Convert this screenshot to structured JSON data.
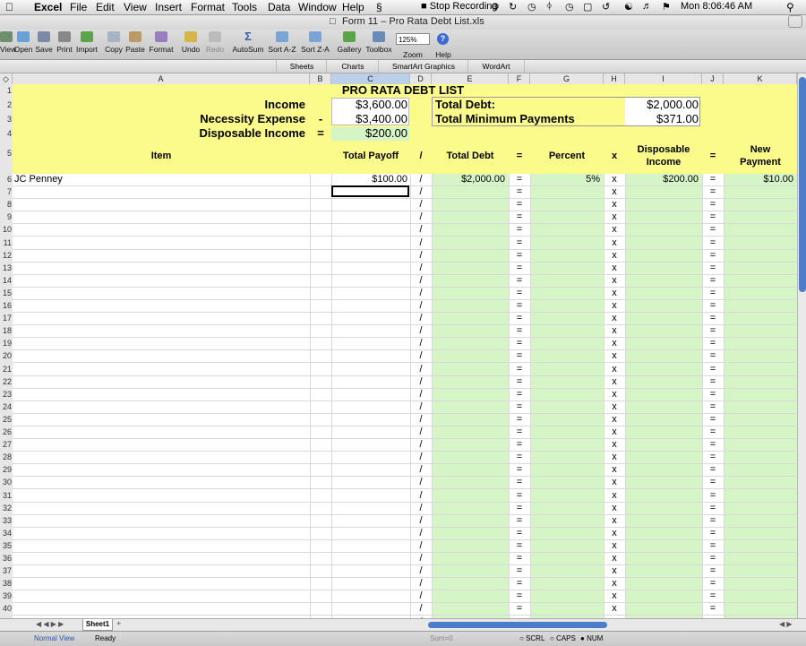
{
  "menubar": {
    "app": "Excel",
    "items": [
      "File",
      "Edit",
      "View",
      "Insert",
      "Format",
      "Tools",
      "Data",
      "Window",
      "Help"
    ],
    "stop_recording": "Stop Recording",
    "clock": "Mon 8:06:46 AM"
  },
  "window": {
    "title": "Form 11 – Pro Rata Debt List.xls"
  },
  "toolbar": {
    "buttons": [
      "View",
      "Open",
      "Save",
      "Print",
      "Import",
      "Copy",
      "Paste",
      "Format",
      "Undo",
      "Redo",
      "AutoSum",
      "Sort A-Z",
      "Sort Z-A",
      "Gallery",
      "Toolbox",
      "Zoom",
      "Help"
    ],
    "zoom_value": "125%"
  },
  "ribbon": {
    "tabs": [
      "Sheets",
      "Charts",
      "SmartArt Graphics",
      "WordArt"
    ]
  },
  "grid": {
    "columns": [
      "A",
      "B",
      "C",
      "D",
      "E",
      "F",
      "G",
      "H",
      "I",
      "J",
      "K"
    ],
    "selected_column": "C",
    "row_numbers": [
      "1",
      "2",
      "3",
      "4",
      "5",
      "6",
      "7",
      "8",
      "9",
      "10",
      "11",
      "12",
      "13",
      "14",
      "15",
      "16",
      "17",
      "18",
      "19",
      "20",
      "21",
      "22",
      "23",
      "24",
      "25",
      "26",
      "27",
      "28",
      "29",
      "30",
      "31",
      "32",
      "33",
      "34",
      "35",
      "36",
      "37",
      "38",
      "39",
      "40",
      "41"
    ]
  },
  "sheet": {
    "title": "PRO RATA DEBT LIST",
    "income_label": "Income",
    "income_value": "$3,600.00",
    "necessity_label": "Necessity Expense",
    "necessity_op": "-",
    "necessity_value": "$3,400.00",
    "disposable_label": "Disposable Income",
    "disposable_op": "=",
    "disposable_value": "$200.00",
    "total_debt_label": "Total Debt:",
    "total_debt_value": "$2,000.00",
    "total_min_label": "Total Minimum Payments",
    "total_min_value": "$371.00",
    "headers": {
      "item": "Item",
      "total_payoff": "Total Payoff",
      "div": "/",
      "total_debt": "Total Debt",
      "eq1": "=",
      "percent": "Percent",
      "times": "x",
      "disposable_income_1": "Disposable",
      "disposable_income_2": "Income",
      "eq2": "=",
      "new_payment_1": "New",
      "new_payment_2": "Payment"
    },
    "rows": [
      {
        "item": "JC Penney",
        "total_payoff": "$100.00",
        "total_debt": "$2,000.00",
        "percent": "5%",
        "disposable_income": "$200.00",
        "new_payment": "$10.00"
      }
    ],
    "op_div": "/",
    "op_eq": "=",
    "op_times": "x"
  },
  "tabs": {
    "sheet1": "Sheet1"
  },
  "status": {
    "view": "Normal View",
    "ready": "Ready",
    "sum": "Sum=0",
    "scrl": "SCRL",
    "caps": "CAPS",
    "num": "NUM"
  },
  "colors": {
    "sheet_yellow": "#fbfb8c",
    "input_green": "#d6f5c6",
    "selection_blue": "#bcd0ea"
  }
}
